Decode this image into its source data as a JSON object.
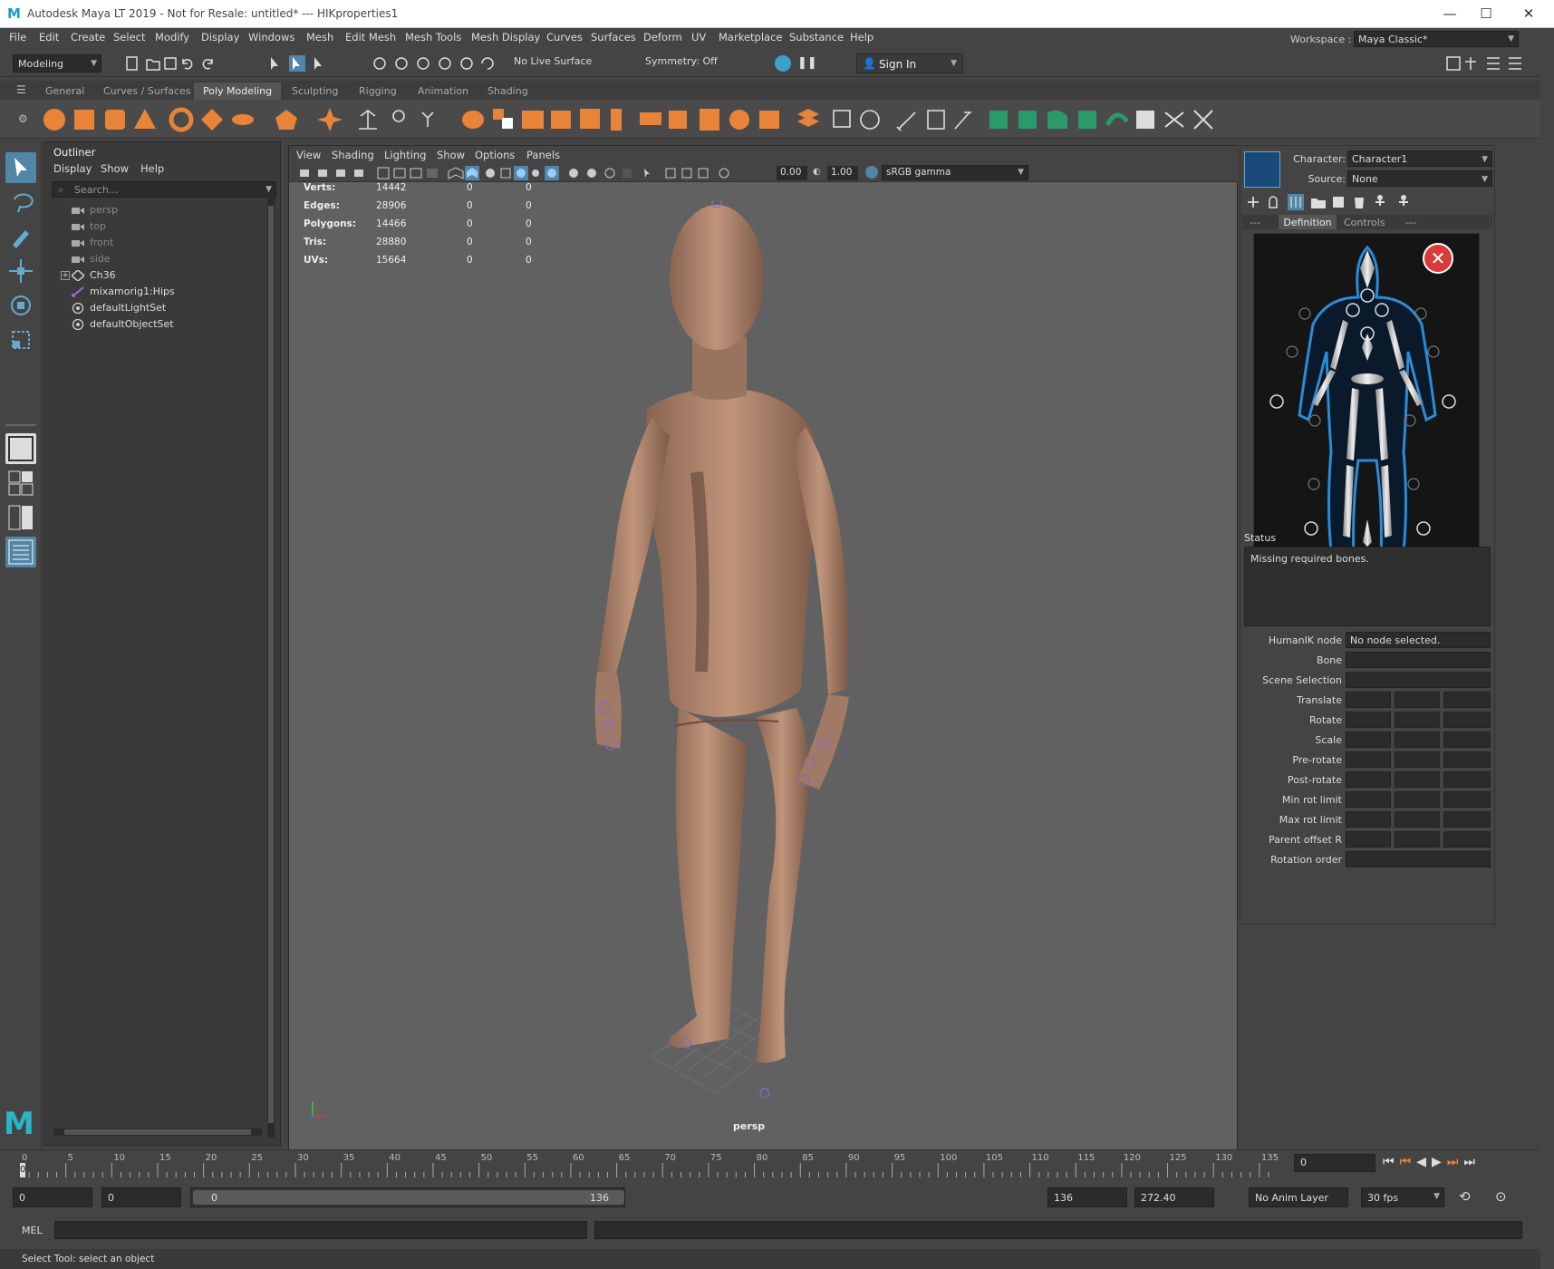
{
  "window": {
    "title": "Autodesk Maya LT 2019 - Not for Resale: untitled*   ---   HIKproperties1",
    "minimize": "—",
    "maximize": "☐",
    "close": "✕"
  },
  "menubar": [
    "File",
    "Edit",
    "Create",
    "Select",
    "Modify",
    "Display",
    "Windows",
    "Mesh",
    "Edit Mesh",
    "Mesh Tools",
    "Mesh Display",
    "Curves",
    "Surfaces",
    "Deform",
    "UV",
    "Marketplace",
    "Substance",
    "Help"
  ],
  "workspace": {
    "label": "Workspace :",
    "value": "Maya Classic*"
  },
  "statusline": {
    "mode": "Modeling",
    "live_surface": "No Live Surface",
    "symmetry": "Symmetry: Off",
    "sign_in": "Sign In"
  },
  "shelf_tabs": [
    "General",
    "Curves / Surfaces",
    "Poly Modeling",
    "Sculpting",
    "Rigging",
    "Animation",
    "Shading"
  ],
  "shelf_active_tab": "Poly Modeling",
  "outliner": {
    "title": "Outliner",
    "menu": [
      "Display",
      "Show",
      "Help"
    ],
    "search_placeholder": "Search...",
    "items": [
      {
        "label": "persp",
        "type": "camera",
        "dim": true
      },
      {
        "label": "top",
        "type": "camera",
        "dim": true
      },
      {
        "label": "front",
        "type": "camera",
        "dim": true
      },
      {
        "label": "side",
        "type": "camera",
        "dim": true
      },
      {
        "label": "Ch36",
        "type": "mesh",
        "dim": false
      },
      {
        "label": "mixamorig1:Hips",
        "type": "joint",
        "dim": false
      },
      {
        "label": "defaultLightSet",
        "type": "set",
        "dim": false
      },
      {
        "label": "defaultObjectSet",
        "type": "set",
        "dim": false
      }
    ]
  },
  "viewport": {
    "menu": [
      "View",
      "Shading",
      "Lighting",
      "Show",
      "Options",
      "Panels"
    ],
    "exposure": "0.00",
    "gamma": "1.00",
    "color_space": "sRGB gamma",
    "camera": "persp",
    "hud": [
      {
        "label": "Verts:",
        "v1": "14442",
        "v2": "0",
        "v3": "0"
      },
      {
        "label": "Edges:",
        "v1": "28906",
        "v2": "0",
        "v3": "0"
      },
      {
        "label": "Polygons:",
        "v1": "14466",
        "v2": "0",
        "v3": "0"
      },
      {
        "label": "Tris:",
        "v1": "28880",
        "v2": "0",
        "v3": "0"
      },
      {
        "label": "UVs:",
        "v1": "15664",
        "v2": "0",
        "v3": "0"
      }
    ]
  },
  "hik": {
    "character_label": "Character:",
    "character_value": "Character1",
    "source_label": "Source:",
    "source_value": "None",
    "tabs": [
      "---",
      "Definition",
      "Controls",
      "---"
    ],
    "active_tab": "Definition",
    "status_title": "Status",
    "status_text": "Missing required bones.",
    "node_label": "HumanIK node",
    "node_value": "No node selected.",
    "fields": [
      "Bone",
      "Scene Selection",
      "Translate",
      "Rotate",
      "Scale",
      "Pre-rotate",
      "Post-rotate",
      "Min rot limit",
      "Max rot limit",
      "Parent offset R",
      "Rotation order"
    ]
  },
  "timeline": {
    "ticks": [
      "0",
      "5",
      "10",
      "15",
      "20",
      "25",
      "30",
      "35",
      "40",
      "45",
      "50",
      "55",
      "60",
      "65",
      "70",
      "75",
      "80",
      "85",
      "90",
      "95",
      "100",
      "105",
      "110",
      "115",
      "120",
      "125",
      "130",
      "135"
    ],
    "current_frame": "0",
    "current_frame_field": "0"
  },
  "range": {
    "start": "0",
    "playback_start": "0",
    "slider_start": "0",
    "slider_end": "136",
    "playback_end": "136",
    "end": "272.40",
    "anim_layer": "No Anim Layer",
    "fps": "30 fps"
  },
  "command": {
    "label": "MEL"
  },
  "help_line": "Select Tool: select an object",
  "colors": {
    "accent": "#5285a6",
    "shelf_orange": "#e8843a",
    "shelf_green": "#2a9a6a",
    "skin": "#b98d74"
  }
}
